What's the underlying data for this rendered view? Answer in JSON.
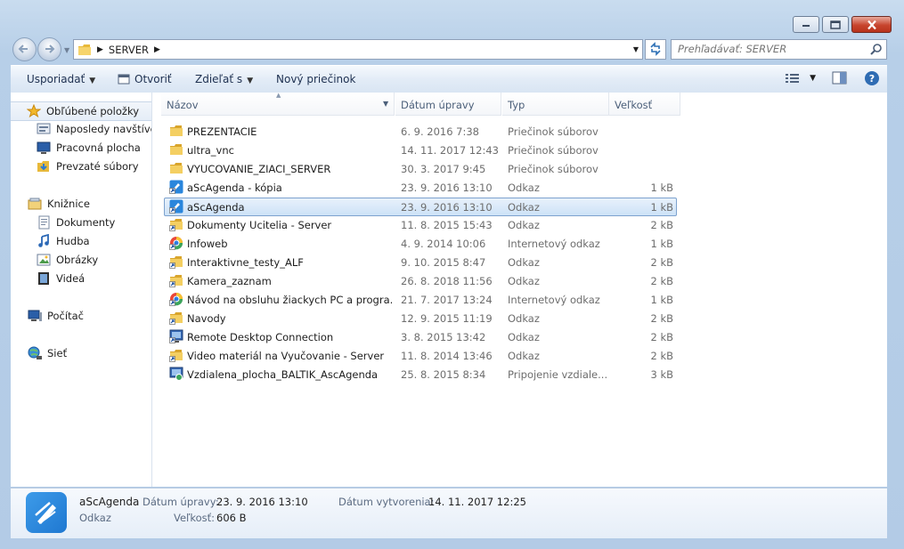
{
  "window": {
    "location": "SERVER",
    "search_placeholder": "Prehľadávať: SERVER"
  },
  "toolbar": {
    "organize": "Usporiadať",
    "open": "Otvoriť",
    "share": "Zdieľať s",
    "new_folder": "Nový priečinok"
  },
  "sidebar": {
    "favorites": "Obľúbené položky",
    "recent": "Naposledy navštívené",
    "desktop": "Pracovná plocha",
    "downloads": "Prevzaté súbory",
    "libraries": "Knižnice",
    "documents": "Dokumenty",
    "music": "Hudba",
    "pictures": "Obrázky",
    "videos": "Videá",
    "computer": "Počítač",
    "network": "Sieť"
  },
  "columns": {
    "name": "Názov",
    "date": "Dátum úpravy",
    "type": "Typ",
    "size": "Veľkosť"
  },
  "files": [
    {
      "name": "PREZENTACIE",
      "date": "6. 9. 2016 7:38",
      "type": "Priečinok súborov",
      "size": "",
      "icon": "folder-icon"
    },
    {
      "name": "ultra_vnc",
      "date": "14. 11. 2017 12:43",
      "type": "Priečinok súborov",
      "size": "",
      "icon": "folder-icon"
    },
    {
      "name": "VYUCOVANIE_ZIACI_SERVER",
      "date": "30. 3. 2017 9:45",
      "type": "Priečinok súborov",
      "size": "",
      "icon": "folder-icon"
    },
    {
      "name": "aScAgenda - kópia",
      "date": "23. 9. 2016 13:10",
      "type": "Odkaz",
      "size": "1 kB",
      "icon": "ascagenda-shortcut-icon"
    },
    {
      "name": "aScAgenda",
      "date": "23. 9. 2016 13:10",
      "type": "Odkaz",
      "size": "1 kB",
      "icon": "ascagenda-shortcut-icon"
    },
    {
      "name": "Dokumenty Ucitelia - Server",
      "date": "11. 8. 2015 15:43",
      "type": "Odkaz",
      "size": "2 kB",
      "icon": "folder-shortcut-icon"
    },
    {
      "name": "Infoweb",
      "date": "4. 9. 2014 10:06",
      "type": "Internetový odkaz",
      "size": "1 kB",
      "icon": "internet-shortcut-icon"
    },
    {
      "name": "Interaktivne_testy_ALF",
      "date": "9. 10. 2015 8:47",
      "type": "Odkaz",
      "size": "2 kB",
      "icon": "folder-shortcut-icon"
    },
    {
      "name": "Kamera_zaznam",
      "date": "26. 8. 2018 11:56",
      "type": "Odkaz",
      "size": "2 kB",
      "icon": "folder-shortcut-icon"
    },
    {
      "name": "Návod na obsluhu žiackych PC a progra...",
      "date": "21. 7. 2017 13:24",
      "type": "Internetový odkaz",
      "size": "1 kB",
      "icon": "internet-shortcut-icon"
    },
    {
      "name": "Navody",
      "date": "12. 9. 2015 11:19",
      "type": "Odkaz",
      "size": "2 kB",
      "icon": "folder-shortcut-icon"
    },
    {
      "name": "Remote Desktop Connection",
      "date": "3. 8. 2015 13:42",
      "type": "Odkaz",
      "size": "2 kB",
      "icon": "remote-desktop-icon"
    },
    {
      "name": "Video materiál na Vyučovanie - Server",
      "date": "11. 8. 2014 13:46",
      "type": "Odkaz",
      "size": "2 kB",
      "icon": "folder-shortcut-icon"
    },
    {
      "name": "Vzdialena_plocha_BALTIK_AscAgenda",
      "date": "25. 8. 2015 8:34",
      "type": "Pripojenie vzdiale...",
      "size": "3 kB",
      "icon": "rdp-file-icon"
    }
  ],
  "selected_index": 4,
  "details": {
    "name": "aScAgenda",
    "type": "Odkaz",
    "modified_label": "Dátum úpravy:",
    "modified_value": "23. 9. 2016 13:10",
    "created_label": "Dátum vytvorenia:",
    "created_value": "14. 11. 2017 12:25",
    "size_label": "Veľkosť:",
    "size_value": "606 B"
  },
  "colors": {
    "accent": "#3399ff",
    "selection": "#cde2f7",
    "folder": "#f0c040"
  }
}
